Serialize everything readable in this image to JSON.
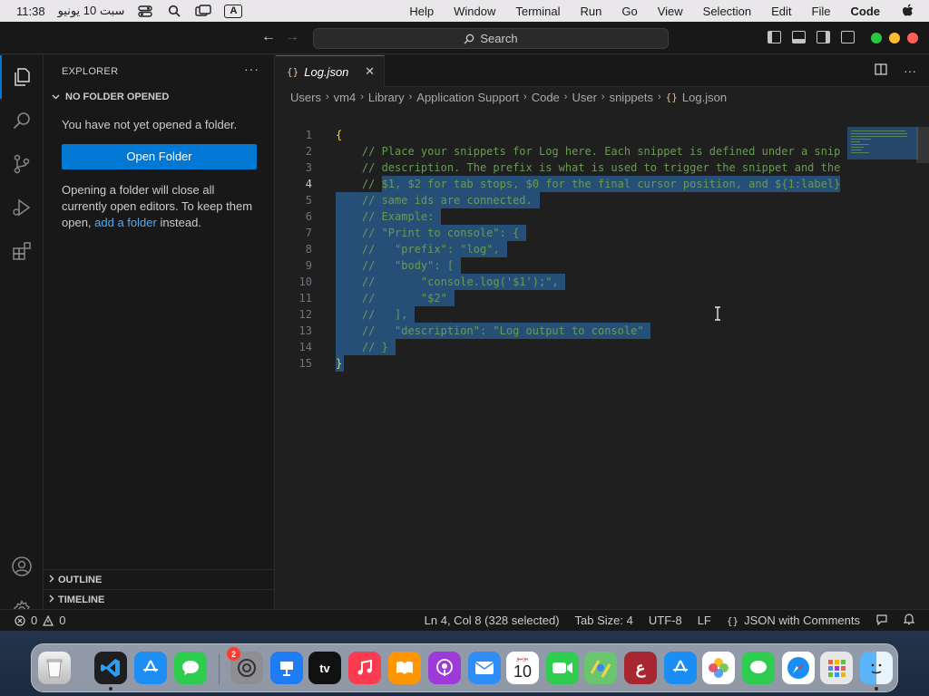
{
  "menubar": {
    "clock": "11:38",
    "date": "سبت 10 يونيو",
    "input_source": "A",
    "menus": [
      "Help",
      "Window",
      "Terminal",
      "Run",
      "Go",
      "View",
      "Selection",
      "Edit",
      "File"
    ],
    "app_name": "Code"
  },
  "titlebar": {
    "search_label": "Search"
  },
  "sidebar": {
    "title": "EXPLORER",
    "section": "NO FOLDER OPENED",
    "message": "You have not yet opened a folder.",
    "open_folder_button": "Open Folder",
    "note_prefix": "Opening a folder will close all currently open editors. To keep them open, ",
    "note_link": "add a folder",
    "note_suffix": " instead.",
    "outline": "OUTLINE",
    "timeline": "TIMELINE"
  },
  "editor": {
    "tab_label": "Log.json",
    "tab_icon": "{}",
    "breadcrumb": [
      "Users",
      "vm4",
      "Library",
      "Application Support",
      "Code",
      "User",
      "snippets"
    ],
    "breadcrumb_file": "Log.json",
    "lines": [
      {
        "n": "1",
        "text": "{"
      },
      {
        "n": "2",
        "text": "    // Place your snippets for Log here. Each snippet is defined under a snip"
      },
      {
        "n": "3",
        "text": "    // description. The prefix is what is used to trigger the snippet and the"
      },
      {
        "n": "4",
        "text": "    // $1, $2 for tab stops, $0 for the final cursor position, and ${1:label}"
      },
      {
        "n": "5",
        "text": "    // same ids are connected."
      },
      {
        "n": "6",
        "text": "    // Example:"
      },
      {
        "n": "7",
        "text": "    // \"Print to console\": {"
      },
      {
        "n": "8",
        "text": "    //   \"prefix\": \"log\","
      },
      {
        "n": "9",
        "text": "    //   \"body\": ["
      },
      {
        "n": "10",
        "text": "    //       \"console.log('$1');\","
      },
      {
        "n": "11",
        "text": "    //       \"$2\""
      },
      {
        "n": "12",
        "text": "    //   ],"
      },
      {
        "n": "13",
        "text": "    //   \"description\": \"Log output to console\""
      },
      {
        "n": "14",
        "text": "    // }"
      },
      {
        "n": "15",
        "text": "}"
      }
    ],
    "current_line": "4"
  },
  "statusbar": {
    "errors": "0",
    "warnings": "0",
    "position": "Ln 4, Col 8 (328 selected)",
    "tab_size": "Tab Size: 4",
    "encoding": "UTF-8",
    "eol": "LF",
    "language_icon": "{}",
    "language": "JSON with Comments"
  },
  "dock": {
    "settings_badge": "2",
    "calendar_month": "يونيو",
    "calendar_day": "10",
    "tv_label": "tv",
    "arabic_app_letter": "ع"
  },
  "colors": {
    "accent": "#0078d4",
    "selection": "#264f78",
    "comment": "#6a9955",
    "link": "#4daafc"
  }
}
